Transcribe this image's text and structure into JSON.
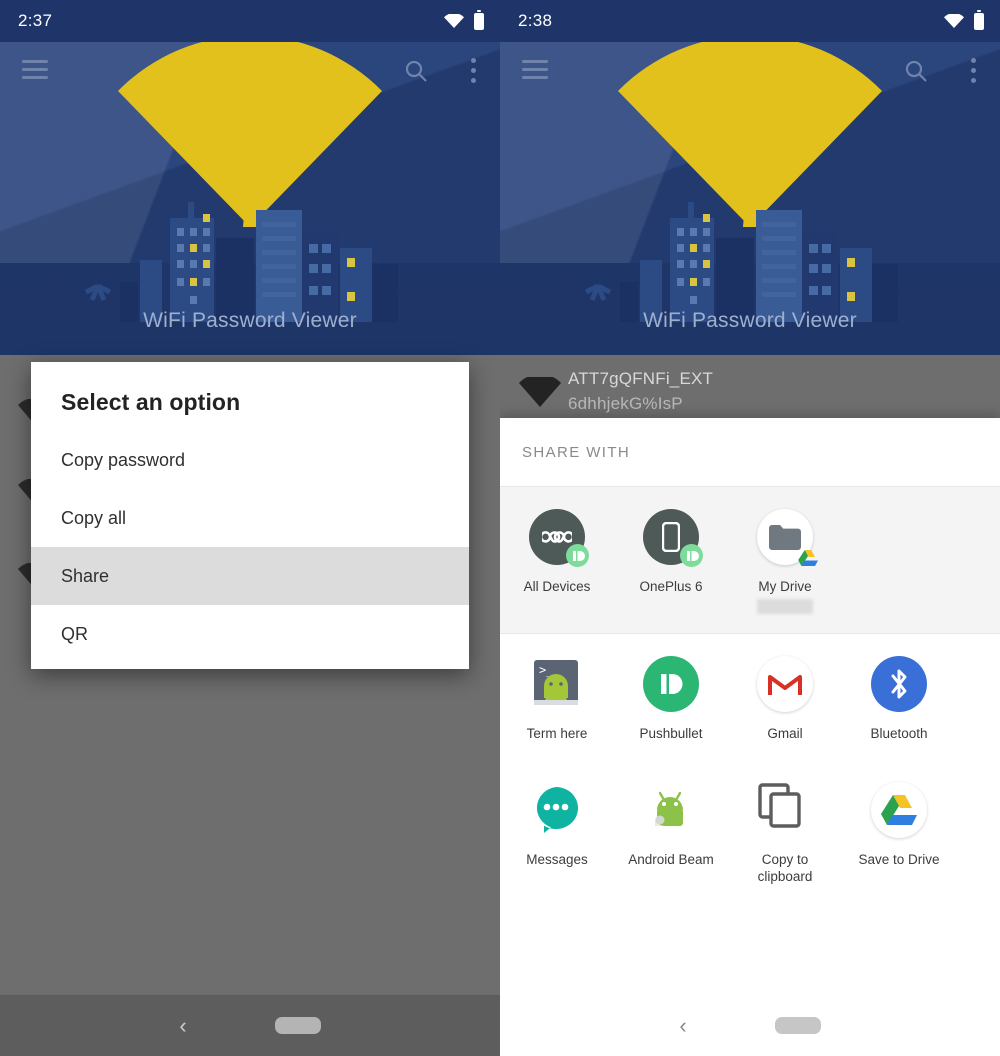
{
  "left": {
    "statusbar": {
      "time": "2:37",
      "wifi_icon": "wifi-icon",
      "battery_icon": "battery-icon"
    },
    "toolbar": {
      "menu_icon": "hamburger-menu-icon",
      "search_icon": "search-icon",
      "overflow_icon": "overflow-menu-icon"
    },
    "app_title": "WiFi Password Viewer",
    "dialog": {
      "title": "Select an option",
      "items": [
        {
          "label": "Copy password",
          "selected": false
        },
        {
          "label": "Copy all",
          "selected": false
        },
        {
          "label": "Share",
          "selected": true
        },
        {
          "label": "QR",
          "selected": false
        }
      ]
    },
    "navbar": {
      "back_icon": "back-chevron-icon",
      "home_icon": "home-pill-icon"
    }
  },
  "right": {
    "statusbar": {
      "time": "2:38",
      "wifi_icon": "wifi-icon",
      "battery_icon": "battery-icon"
    },
    "toolbar": {
      "menu_icon": "hamburger-menu-icon",
      "search_icon": "search-icon",
      "overflow_icon": "overflow-menu-icon"
    },
    "app_title": "WiFi Password Viewer",
    "network": {
      "ssid": "ATT7gQFNFi_EXT",
      "password": "6dhhjekG%IsP",
      "signal_icon": "wifi-signal-icon"
    },
    "share_sheet": {
      "header": "SHARE WITH",
      "row1": [
        {
          "label": "All Devices",
          "icon": "infinity-icon",
          "badge": "pushbullet-badge-icon",
          "style": "slate",
          "redacted": false
        },
        {
          "label": "OnePlus 6",
          "icon": "phone-icon",
          "badge": "pushbullet-badge-icon",
          "style": "slate",
          "redacted": false
        },
        {
          "label": "My Drive",
          "icon": "folder-icon",
          "badge": "google-drive-badge-icon",
          "style": "white",
          "redacted": true
        }
      ],
      "row2": [
        {
          "label": "Term here",
          "icon": "terminal-android-icon"
        },
        {
          "label": "Pushbullet",
          "icon": "pushbullet-icon"
        },
        {
          "label": "Gmail",
          "icon": "gmail-icon"
        },
        {
          "label": "Bluetooth",
          "icon": "bluetooth-icon"
        }
      ],
      "row3": [
        {
          "label": "Messages",
          "icon": "messages-icon"
        },
        {
          "label": "Android Beam",
          "icon": "android-beam-icon"
        },
        {
          "label": "Copy to clipboard",
          "icon": "copy-clipboard-icon"
        },
        {
          "label": "Save to Drive",
          "icon": "google-drive-icon"
        }
      ]
    },
    "navbar": {
      "back_icon": "back-chevron-icon",
      "home_icon": "home-pill-icon"
    }
  },
  "colors": {
    "banner_blue": "#223a70",
    "status_blue": "#1f3468",
    "wifi_yellow": "#e2c11c",
    "scrim_gray": "#6e6e6e",
    "selected_row": "#dcdcdc",
    "pushbullet_green": "#2bb673",
    "bluetooth_blue": "#3a6fd8",
    "messages_teal": "#0fb3a1"
  }
}
